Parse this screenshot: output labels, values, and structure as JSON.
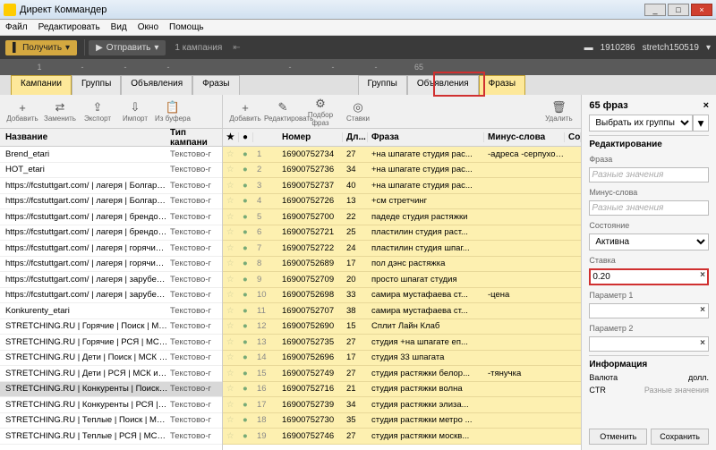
{
  "titlebar": {
    "title": "Директ Коммандер"
  },
  "menu": [
    "Файл",
    "Редактировать",
    "Вид",
    "Окно",
    "Помощь"
  ],
  "darkbar": {
    "get": "Получить",
    "send": "Отправить",
    "campaign": "1 кампания",
    "user_id": "1910286",
    "user_name": "stretch150519"
  },
  "counts": {
    "left": [
      "1",
      "-",
      "-",
      "-"
    ],
    "right": [
      "-",
      "-",
      "-",
      "65"
    ]
  },
  "tabs": {
    "left": [
      "Кампании",
      "Группы",
      "Объявления",
      "Фразы"
    ],
    "right": [
      "Группы",
      "Объявления",
      "Фразы"
    ]
  },
  "left_toolbar": [
    {
      "icon": "+",
      "label": "Добавить"
    },
    {
      "icon": "⇄",
      "label": "Заменить"
    },
    {
      "icon": "⇪",
      "label": "Экспорт"
    },
    {
      "icon": "⇩",
      "label": "Импорт"
    },
    {
      "icon": "📋",
      "label": "Из буфера"
    }
  ],
  "left_head": {
    "c1": "Название",
    "c2": "Тип кампани"
  },
  "left_rows": [
    {
      "name": "Brend_etari",
      "type": "Текстово-г"
    },
    {
      "name": "HOT_etari",
      "type": "Текстово-г"
    },
    {
      "name": "https://fcstuttgart.com/ | лагеря | Болгария | ...",
      "type": "Текстово-г"
    },
    {
      "name": "https://fcstuttgart.com/ | лагеря | Болгария | ...",
      "type": "Текстово-г"
    },
    {
      "name": "https://fcstuttgart.com/ | лагеря | брендовые ...",
      "type": "Текстово-г"
    },
    {
      "name": "https://fcstuttgart.com/ | лагеря | брендовые ...",
      "type": "Текстово-г"
    },
    {
      "name": "https://fcstuttgart.com/ | лагеря | горячие | ...",
      "type": "Текстово-г"
    },
    {
      "name": "https://fcstuttgart.com/ | лагеря | горячие | ...",
      "type": "Текстово-г"
    },
    {
      "name": "https://fcstuttgart.com/ | лагеря | зарубеж | ...",
      "type": "Текстово-г"
    },
    {
      "name": "https://fcstuttgart.com/ | лагеря | зарубеж | ...",
      "type": "Текстово-г"
    },
    {
      "name": "Konkurenty_etari",
      "type": "Текстово-г"
    },
    {
      "name": "STRETCHING.RU | Горячие | Поиск | МСК и ...",
      "type": "Текстово-г"
    },
    {
      "name": "STRETCHING.RU | Горячие | РСЯ | МСК и о...",
      "type": "Текстово-г"
    },
    {
      "name": "STRETCHING.RU | Дети | Поиск | МСК и обл",
      "type": "Текстово-г"
    },
    {
      "name": "STRETCHING.RU | Дети | РСЯ | МСК и обл",
      "type": "Текстово-г"
    },
    {
      "name": "STRETCHING.RU | Конкуренты | Поиск | М...",
      "type": "Текстово-г",
      "sel": true
    },
    {
      "name": "STRETCHING.RU | Конкуренты | РСЯ | М...",
      "type": "Текстово-г"
    },
    {
      "name": "STRETCHING.RU | Теплые | Поиск | МСК и ...",
      "type": "Текстово-г"
    },
    {
      "name": "STRETCHING.RU | Теплые | РСЯ | МСК и о...",
      "type": "Текстово-г"
    }
  ],
  "center_toolbar": [
    {
      "icon": "+",
      "label": "Добавить"
    },
    {
      "icon": "✎",
      "label": "Редактировать"
    },
    {
      "icon": "⚙",
      "label": "Подбор фраз"
    },
    {
      "icon": "◎",
      "label": "Ставки"
    }
  ],
  "center_toolbar_right": {
    "icon": "🗑",
    "label": "Удалить"
  },
  "center_head": [
    "★",
    "●",
    "",
    "Номер",
    "Дл...",
    "Фраза",
    "Минус-слова",
    "Co"
  ],
  "center_rows": [
    {
      "n": "1",
      "id": "16900752734",
      "len": "27",
      "phrase": "+на шпагате студия рас...",
      "minus": "-адреса -серпуховская ..."
    },
    {
      "n": "2",
      "id": "16900752736",
      "len": "34",
      "phrase": "+на шпагате студия рас...",
      "minus": ""
    },
    {
      "n": "3",
      "id": "16900752737",
      "len": "40",
      "phrase": "+на шпагате студия рас...",
      "minus": ""
    },
    {
      "n": "4",
      "id": "16900752726",
      "len": "13",
      "phrase": "+см стретчинг",
      "minus": ""
    },
    {
      "n": "5",
      "id": "16900752700",
      "len": "22",
      "phrase": "падеде студия растяжки",
      "minus": ""
    },
    {
      "n": "6",
      "id": "16900752721",
      "len": "25",
      "phrase": "пластилин студия раст...",
      "minus": ""
    },
    {
      "n": "7",
      "id": "16900752722",
      "len": "24",
      "phrase": "пластилин студия шпаг...",
      "minus": ""
    },
    {
      "n": "8",
      "id": "16900752689",
      "len": "17",
      "phrase": "пол дэнс растяжка",
      "minus": ""
    },
    {
      "n": "9",
      "id": "16900752709",
      "len": "20",
      "phrase": "просто шпагат студия",
      "minus": ""
    },
    {
      "n": "10",
      "id": "16900752698",
      "len": "33",
      "phrase": "самира мустафаева ст...",
      "minus": "-цена"
    },
    {
      "n": "11",
      "id": "16900752707",
      "len": "38",
      "phrase": "самира мустафаева ст...",
      "minus": ""
    },
    {
      "n": "12",
      "id": "16900752690",
      "len": "15",
      "phrase": "Сплит Лайн Клаб",
      "minus": ""
    },
    {
      "n": "13",
      "id": "16900752735",
      "len": "27",
      "phrase": "студия +на шпагате еп...",
      "minus": ""
    },
    {
      "n": "14",
      "id": "16900752696",
      "len": "17",
      "phrase": "студия 33 шпагата",
      "minus": ""
    },
    {
      "n": "15",
      "id": "16900752749",
      "len": "27",
      "phrase": "студия растяжки белор...",
      "minus": "-тянучка"
    },
    {
      "n": "16",
      "id": "16900752716",
      "len": "21",
      "phrase": "студия растяжки волна",
      "minus": ""
    },
    {
      "n": "17",
      "id": "16900752739",
      "len": "34",
      "phrase": "студия растяжки элиза...",
      "minus": ""
    },
    {
      "n": "18",
      "id": "16900752730",
      "len": "35",
      "phrase": "студия растяжки метро ...",
      "minus": ""
    },
    {
      "n": "19",
      "id": "16900752746",
      "len": "27",
      "phrase": "студия растяжки москв...",
      "minus": ""
    }
  ],
  "right": {
    "title": "65 фраз",
    "select_btn": "Выбрать их группы",
    "sect_edit": "Редактирование",
    "lbl_phrase": "Фраза",
    "ph_diff": "Разные значения",
    "lbl_minus": "Минус-слова",
    "lbl_state": "Состояние",
    "state_val": "Активна",
    "lbl_rate": "Ставка",
    "rate_val": "0.20",
    "lbl_p1": "Параметр 1",
    "lbl_p2": "Параметр 2",
    "sect_info": "Информация",
    "lbl_currency": "Валюта",
    "val_currency": "долл.",
    "lbl_ctr": "CTR",
    "val_ctr": "Разные значения",
    "btn_cancel": "Отменить",
    "btn_save": "Сохранить"
  }
}
